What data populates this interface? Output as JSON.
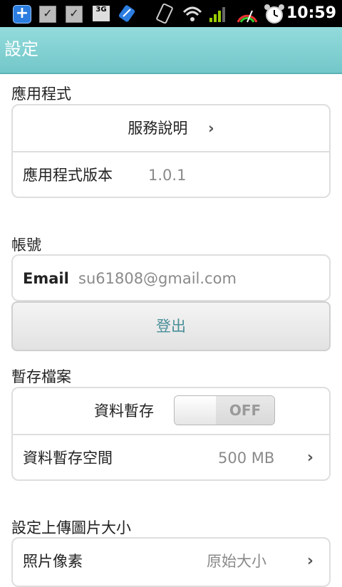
{
  "status_bar": {
    "time": "10:59",
    "network_label": "3G"
  },
  "header": {
    "title": "設定"
  },
  "sections": {
    "app": {
      "title": "應用程式",
      "service_label": "服務說明",
      "version_label": "應用程式版本",
      "version_value": "1.0.1"
    },
    "account": {
      "title": "帳號",
      "email_label": "Email",
      "email_value": "su61808@gmail.com",
      "logout_label": "登出"
    },
    "cache": {
      "title": "暫存檔案",
      "cache_label": "資料暫存",
      "cache_state": "OFF",
      "space_label": "資料暫存空間",
      "space_value": "500 MB"
    },
    "upload": {
      "title": "設定上傳圖片大小",
      "pixel_label": "照片像素",
      "pixel_value": "原始大小"
    }
  },
  "colors": {
    "header_bg": "#73c7c9",
    "accent_text": "#4a8f99"
  }
}
